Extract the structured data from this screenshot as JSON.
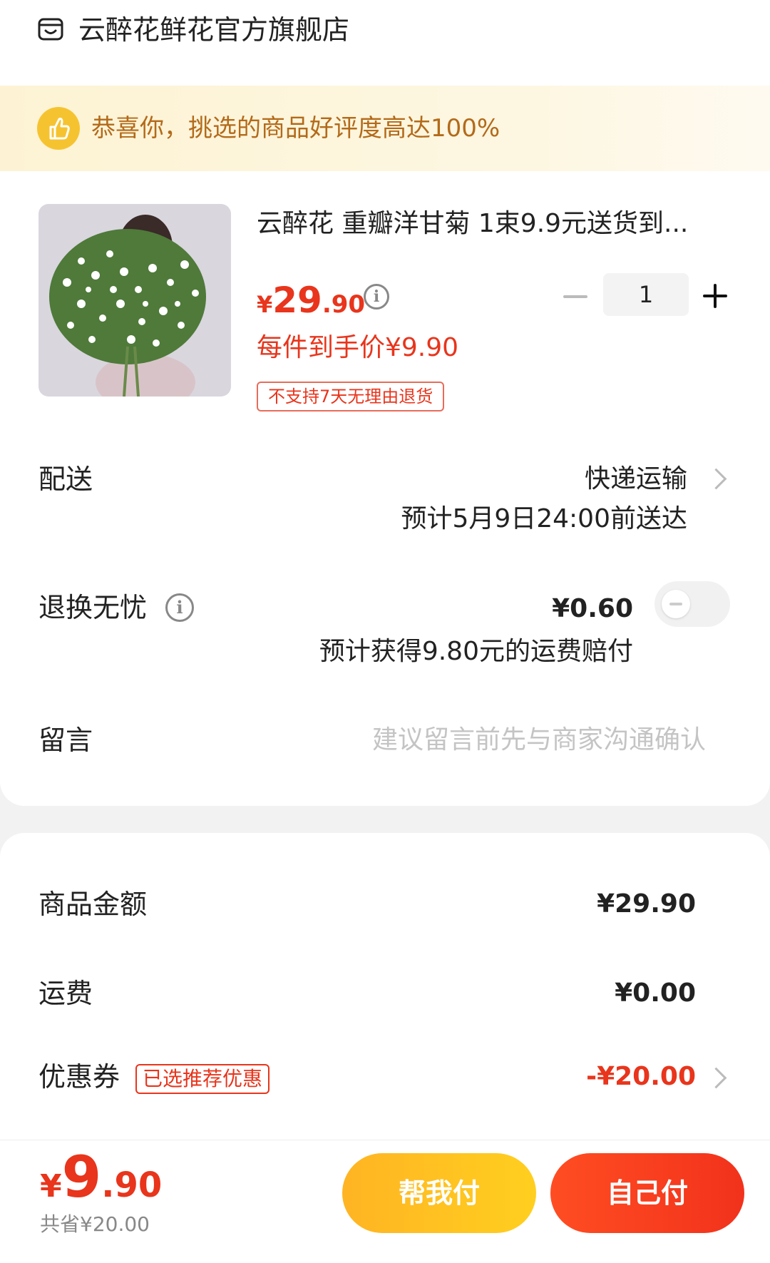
{
  "store": {
    "name": "云醉花鲜花官方旗舰店",
    "icon": "store-icon"
  },
  "banner": {
    "text": "恭喜你，挑选的商品好评度高达100%",
    "icon": "thumbs-up-icon"
  },
  "product": {
    "title": "云醉花 重瓣洋甘菊 1束9.9元送货到...",
    "price_symbol": "¥",
    "price_int": "29",
    "price_dec": ".90",
    "per_price": "每件到手价¥9.90",
    "tag": "不支持7天无理由退货",
    "quantity": "1"
  },
  "delivery": {
    "label": "配送",
    "method": "快递运输",
    "eta": "预计5月9日24:00前送达"
  },
  "return_insurance": {
    "label": "退换无忧",
    "price": "¥0.60",
    "desc": "预计获得9.80元的运费赔付",
    "enabled": false
  },
  "message": {
    "label": "留言",
    "placeholder": "建议留言前先与商家沟通确认"
  },
  "summary": {
    "goods_label": "商品金额",
    "goods_value": "¥29.90",
    "shipping_label": "运费",
    "shipping_value": "¥0.00",
    "coupon_label": "优惠券",
    "coupon_tag": "已选推荐优惠",
    "coupon_value": "-¥20.00"
  },
  "footer": {
    "total_symbol": "¥",
    "total_int": "9",
    "total_dec": ".90",
    "saved": "共省¥20.00",
    "help_pay": "帮我付",
    "self_pay": "自己付"
  },
  "colors": {
    "accent_red": "#e8351c",
    "accent_yellow": "#ffc222",
    "banner_text": "#b36a1a"
  }
}
